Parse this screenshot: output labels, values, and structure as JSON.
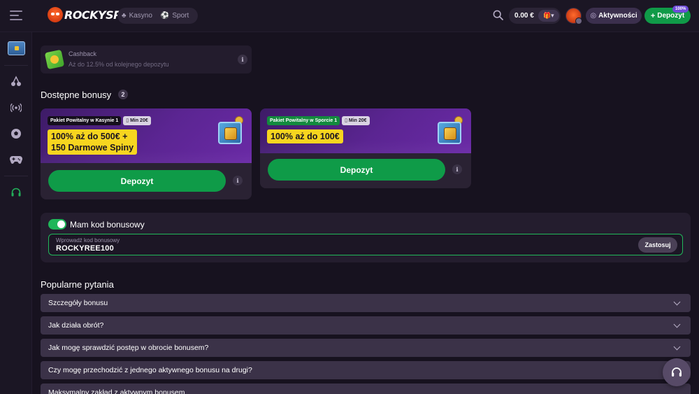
{
  "header": {
    "logo_text": "ROCKYSPIN",
    "nav": [
      {
        "label": "Kasyno",
        "icon": "cherry-icon"
      },
      {
        "label": "Sport",
        "icon": "soccer-ball-icon"
      }
    ],
    "balance": "0.00 €",
    "activity_label": "Aktywności",
    "deposit_label": "Depozyt",
    "deposit_badge": "100%"
  },
  "sidebar": {
    "items": [
      {
        "icon": "treasure-chest-icon"
      },
      {
        "icon": "cherry-icon"
      },
      {
        "icon": "live-broadcast-icon"
      },
      {
        "icon": "soccer-ball-icon"
      },
      {
        "icon": "gamepad-icon"
      },
      {
        "icon": "headset-icon"
      }
    ]
  },
  "cashback": {
    "title": "Cashback",
    "description": "Aż do 12.5% od kolejnego depozytu"
  },
  "bonuses": {
    "title": "Dostępne bonusy",
    "count": "2",
    "cards": [
      {
        "tag": "Pakiet Powitalny w Kasynie 1",
        "min": "Min 20€",
        "promo_line1": "100% aż do 500€ +",
        "promo_line2": "150 Darmowe Spiny",
        "button": "Depozyt"
      },
      {
        "tag": "Pakiet Powitalny w Sporcie 1",
        "min": "Min 20€",
        "promo_line1": "100% aż do 100€",
        "button": "Depozyt"
      }
    ]
  },
  "bonus_code": {
    "toggle_label": "Mam kod bonusowy",
    "toggle_on": true,
    "placeholder": "Wprowadź kod bonusowy",
    "value": "ROCKYREE100",
    "apply_label": "Zastosuj"
  },
  "faq": {
    "title": "Popularne pytania",
    "items": [
      "Szczegóły bonusu",
      "Jak działa obrót?",
      "Jak mogę sprawdzić postęp w obrocie bonusem?",
      "Czy mogę przechodzić z jednego aktywnego bonusu na drugi?",
      "Maksymalny zakład z aktywnym bonusem"
    ]
  },
  "colors": {
    "background": "#17121f",
    "accent_green": "#0f9b48",
    "promo_yellow": "#f7d51f",
    "card_purple": "#5b2592"
  }
}
